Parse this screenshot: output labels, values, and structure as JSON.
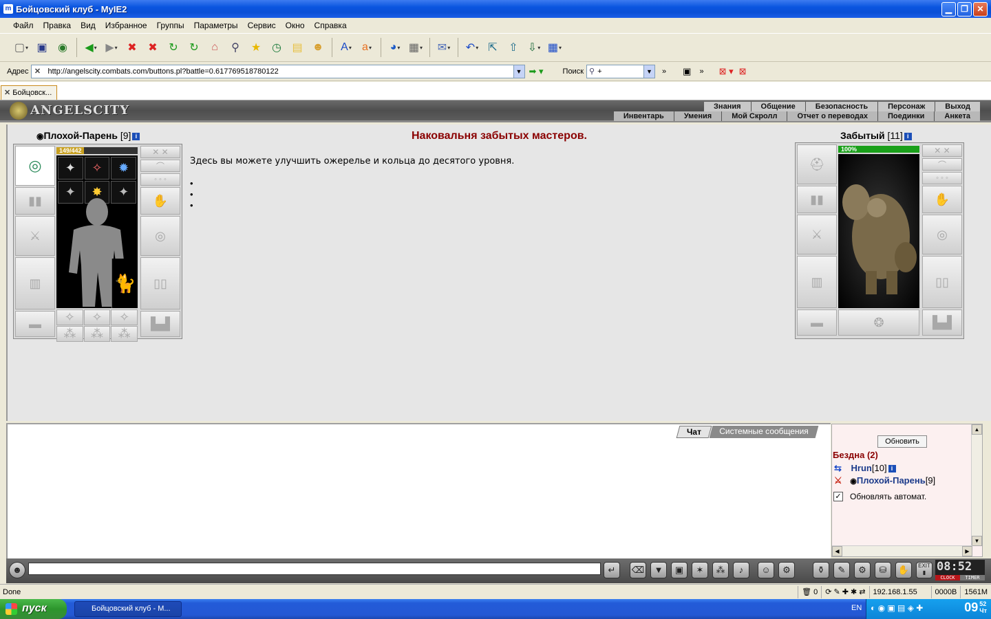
{
  "window": {
    "title": "Бойцовский клуб - MyIE2",
    "app_icon": "m"
  },
  "menu": [
    "Файл",
    "Правка",
    "Вид",
    "Избранное",
    "Группы",
    "Параметры",
    "Сервис",
    "Окно",
    "Справка"
  ],
  "address": {
    "label": "Адрес",
    "url": "http://angelscity.combats.com/buttons.pl?battle=0.617769518780122"
  },
  "search": {
    "label": "Поиск",
    "value": "+"
  },
  "tab": {
    "label": "Бойцовск..."
  },
  "game": {
    "logo": "ANGELSCITY",
    "nav_top": [
      "Знания",
      "Общение",
      "Безопасность",
      "Персонаж",
      "Выход"
    ],
    "nav_bottom": [
      "Инвентарь",
      "Умения",
      "Мой Скролл",
      "Отчет о переводах",
      "Поединки",
      "Анкета"
    ],
    "heading": "Наковальня забытых мастеров.",
    "text": "Здесь вы можете улучшить ожерелье и кольца до десятого уровня.",
    "player": {
      "name": "Плохой-Парень",
      "level": "[9]",
      "hp": "149/442",
      "hp_fraction": 0.337
    },
    "opponent": {
      "name": "Забытый",
      "level": "[11]",
      "hp": "100%",
      "hp_fraction": 1.0
    }
  },
  "chat": {
    "tabs": [
      "Чат",
      "Системные сообщения"
    ],
    "online": {
      "refresh_label": "Обновить",
      "room": "Бездна (2)",
      "users": [
        {
          "name": "Hrun",
          "level": "[10]"
        },
        {
          "name": "Плохой-Парень",
          "level": "[9]"
        }
      ],
      "auto_label": "Обновлять автомат."
    },
    "clock": {
      "time": "08:52",
      "label_clock": "CLOCK",
      "label_timer": "TIMER",
      "exit": "EXIT"
    }
  },
  "status": {
    "text": "Done",
    "cell1": "0",
    "ip": "192.168.1.55",
    "bytes": "0000B",
    "speed": "1561M"
  },
  "taskbar": {
    "start": "пуск",
    "task": "Бойцовский клуб - M...",
    "lang": "EN",
    "time": "09",
    "minutes": "52",
    "day": "Чт"
  }
}
